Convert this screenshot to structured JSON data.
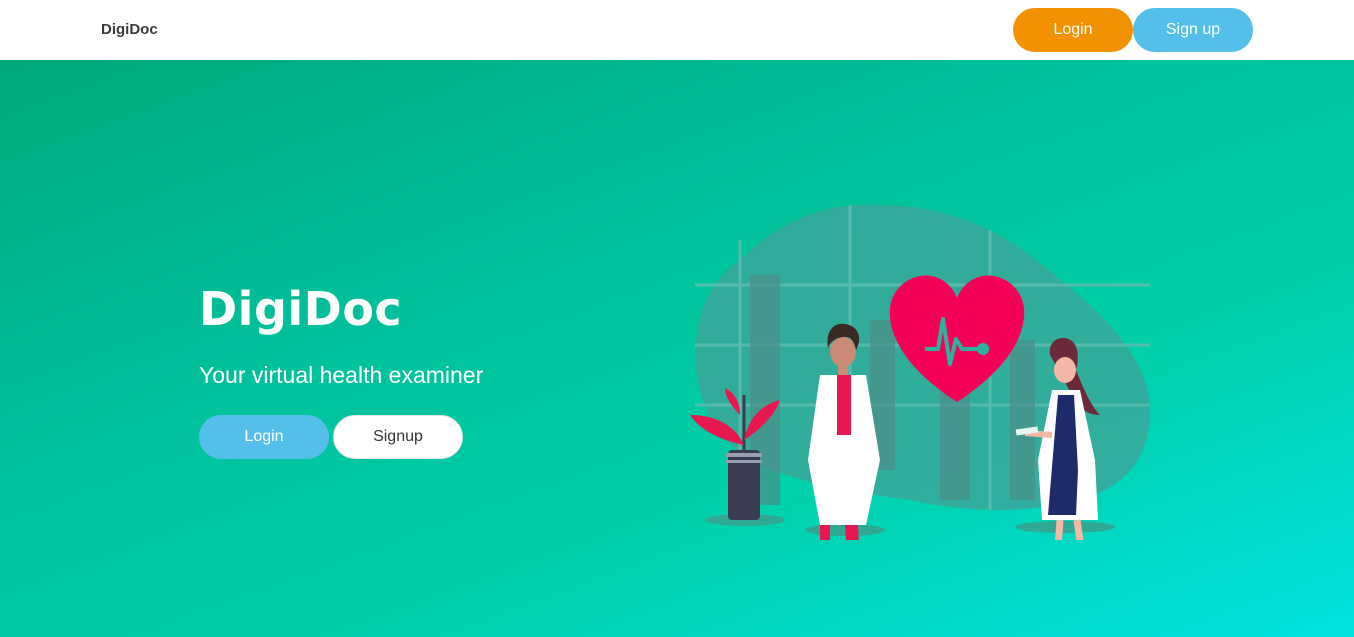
{
  "navbar": {
    "brand": "DigiDoc",
    "login_label": "Login",
    "signup_label": "Sign up"
  },
  "hero": {
    "title": "DigiDoc",
    "subtitle": "Your virtual health examiner",
    "login_label": "Login",
    "signup_label": "Signup"
  },
  "colors": {
    "nav_login": "#f29200",
    "nav_signup": "#54bfea",
    "hero_gradient_start": "#00a87a",
    "hero_gradient_end": "#00e2e0",
    "heart": "#f50057",
    "doctor_coat": "#ffffff",
    "scrubs": "#e8174f"
  },
  "illustration": {
    "icon": "doctors-heart-illustration"
  }
}
